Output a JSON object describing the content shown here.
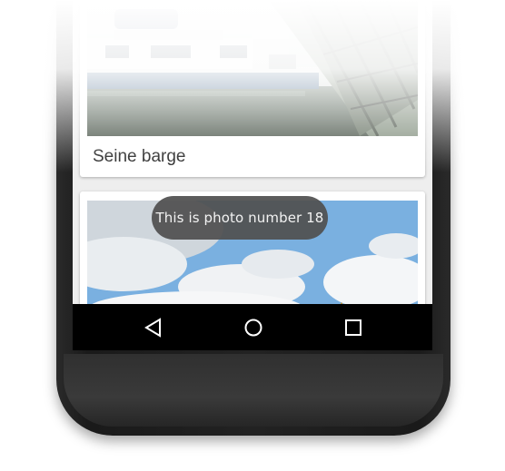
{
  "cards": [
    {
      "caption": "Seine barge"
    },
    {
      "caption": ""
    }
  ],
  "toast": {
    "text": "This is photo number 18"
  },
  "navbar": {
    "back_icon": "back-triangle-icon",
    "home_icon": "home-circle-icon",
    "recents_icon": "recents-square-icon"
  },
  "colors": {
    "navbar": "#000000",
    "toast": "#505050",
    "card": "#ffffff",
    "screen": "#eeeeee"
  }
}
